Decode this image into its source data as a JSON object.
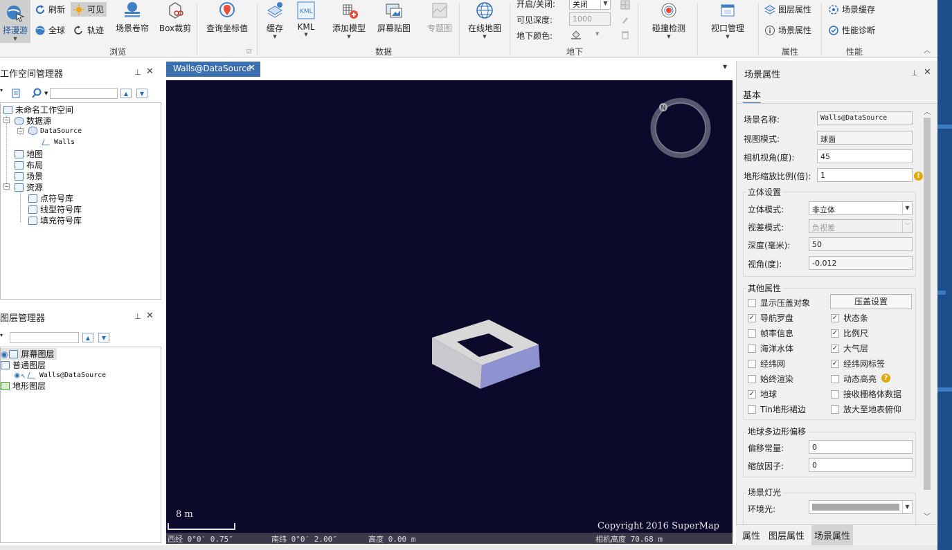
{
  "ribbon": {
    "left_partial_label": "择漫游",
    "refresh": "刷新",
    "visible": "可见",
    "globe_all": "全球",
    "track": "轨迹",
    "scene_roller": "场景卷帘",
    "box_clip": "Box裁剪",
    "query_coord": "查询坐标值",
    "group_browse": "浏览",
    "cache": "缓存",
    "kml": "KML",
    "add_model": "添加模型",
    "screen_map": "屏幕贴图",
    "thematic": "专题图",
    "online_map": "在线地图",
    "group_data": "数据",
    "underground_toggle_label": "开启/关闭:",
    "underground_toggle_value": "关闭",
    "visible_depth_label": "可见深度:",
    "visible_depth_value": "1000",
    "underground_color_label": "地下颜色:",
    "group_underground": "地下",
    "collision": "碰撞检测",
    "viewport_mgr": "视口管理",
    "layer_props": "图层属性",
    "scene_props": "场景属性",
    "group_props": "属性",
    "scene_cache": "场景缓存",
    "perf_diag": "性能诊断",
    "group_perf": "性能"
  },
  "workspace": {
    "title": "工作空间管理器",
    "root": "未命名工作空间",
    "datasources": "数据源",
    "datasource": "DataSource",
    "dataset": "Walls",
    "map": "地图",
    "layout": "布局",
    "scene": "场景",
    "resources": "资源",
    "point_lib": "点符号库",
    "line_lib": "线型符号库",
    "fill_lib": "填充符号库"
  },
  "layers": {
    "title": "图层管理器",
    "screen_layer": "屏幕图层",
    "normal_layer": "普通图层",
    "walls_layer": "Walls@DataSource",
    "terrain_layer": "地形图层"
  },
  "doc": {
    "tab_label": "Walls@DataSource",
    "scale": "8 m",
    "copyright": "Copyright 2016 SuperMap",
    "lon": "西经 0°0′ 0.75″",
    "lat": "南纬 0°0′ 2.00″",
    "alt": "高度 0.00 m",
    "cam_height": "相机高度 70.68 m"
  },
  "props": {
    "title": "场景属性",
    "tab_basic": "基本",
    "scene_name_label": "场景名称:",
    "scene_name": "Walls@DataSource",
    "view_mode_label": "视图模式:",
    "view_mode": "球面",
    "fov_label": "相机视角(度):",
    "fov": "45",
    "terrain_scale_label": "地形缩放比例(倍):",
    "terrain_scale": "1",
    "stereo_title": "立体设置",
    "stereo_mode_label": "立体模式:",
    "stereo_mode": "非立体",
    "parallax_label": "视差模式:",
    "parallax": "负视差",
    "depth_label": "深度(毫米):",
    "depth": "50",
    "angle_label": "视角(度):",
    "angle": "-0.012",
    "other_title": "其他属性",
    "show_overlay": "显示压盖对象",
    "overlay_settings": "压盖设置",
    "nav_compass": "导航罗盘",
    "status_bar": "状态条",
    "fps_info": "帧率信息",
    "scale_bar": "比例尺",
    "ocean": "海洋水体",
    "atmosphere": "大气层",
    "graticule": "经纬网",
    "graticule_label": "经纬网标签",
    "always_render": "始终渲染",
    "dynamic_highlight": "动态高亮",
    "globe": "地球",
    "receive_grid": "接收栅格体数据",
    "tin_skirt": "Tin地形裙边",
    "zoom_below": "放大至地表俯仰",
    "offset_title": "地球多边形偏移",
    "offset_const_label": "偏移常量:",
    "offset_const": "0",
    "scale_factor_label": "缩放因子:",
    "scale_factor": "0",
    "light_title": "场景灯光",
    "ambient_label": "环境光:"
  },
  "bottom_tabs": [
    "属性",
    "图层属性",
    "场景属性"
  ]
}
